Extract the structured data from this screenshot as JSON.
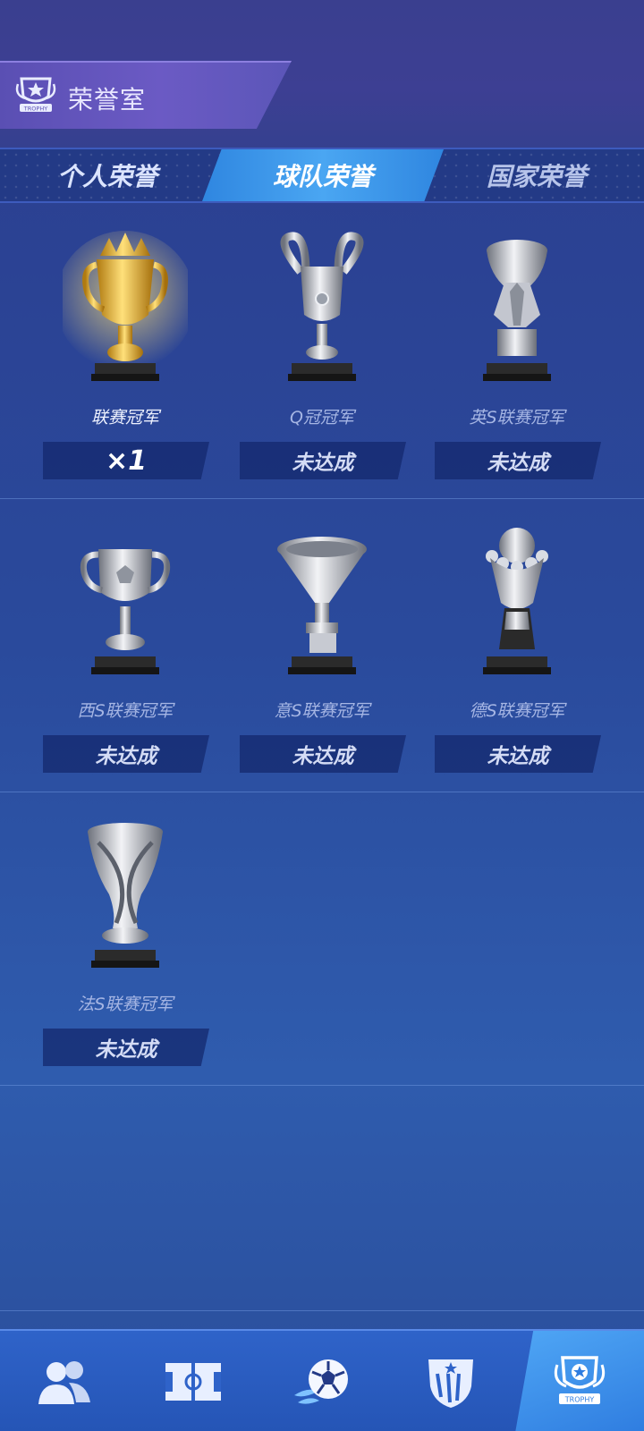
{
  "header": {
    "title": "荣誉室",
    "badge_text": "TROPHY"
  },
  "tabs": [
    {
      "label": "个人荣誉",
      "active": false
    },
    {
      "label": "球队荣誉",
      "active": true
    },
    {
      "label": "国家荣誉",
      "active": false
    }
  ],
  "trophies": [
    {
      "name": "联赛冠军",
      "status": "×1",
      "achieved": true,
      "icon": "gold-crown-trophy-icon"
    },
    {
      "name": "Q冠冠军",
      "status": "未达成",
      "achieved": false,
      "icon": "big-ears-cup-icon"
    },
    {
      "name": "英S联赛冠军",
      "status": "未达成",
      "achieved": false,
      "icon": "winged-trophy-icon"
    },
    {
      "name": "西S联赛冠军",
      "status": "未达成",
      "achieved": false,
      "icon": "handled-cup-icon"
    },
    {
      "name": "意S联赛冠军",
      "status": "未达成",
      "achieved": false,
      "icon": "funnel-cup-icon"
    },
    {
      "name": "德S联赛冠军",
      "status": "未达成",
      "achieved": false,
      "icon": "ball-crown-trophy-icon"
    },
    {
      "name": "法S联赛冠军",
      "status": "未达成",
      "achieved": false,
      "icon": "twisted-vase-trophy-icon"
    }
  ],
  "bottom_nav": [
    {
      "icon": "team-people-icon",
      "active": false
    },
    {
      "icon": "pitch-icon",
      "active": false
    },
    {
      "icon": "soccer-ball-icon",
      "active": false
    },
    {
      "icon": "club-crest-icon",
      "active": false
    },
    {
      "icon": "trophy-badge-icon",
      "active": true,
      "badge_text": "TROPHY"
    }
  ],
  "colors": {
    "gold": "#f3c64a",
    "silver": "#c8ccd6",
    "accent_blue": "#3f9cf0"
  }
}
